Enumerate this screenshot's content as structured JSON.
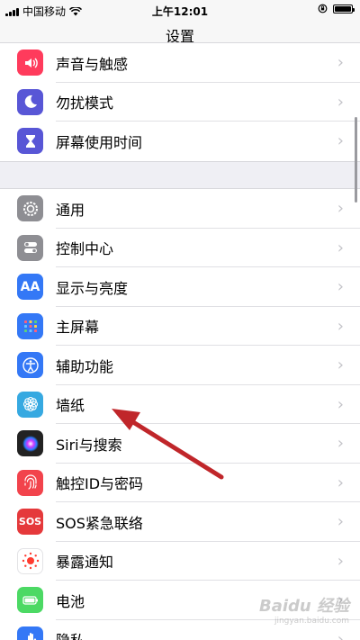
{
  "status_bar": {
    "carrier": "中国移动",
    "time": "上午12:01"
  },
  "nav": {
    "title": "设置"
  },
  "group1": [
    {
      "label": "声音与触感",
      "icon": "speaker-icon",
      "color": "#ff3b5c"
    },
    {
      "label": "勿扰模式",
      "icon": "moon-icon",
      "color": "#5856d6"
    },
    {
      "label": "屏幕使用时间",
      "icon": "hourglass-icon",
      "color": "#5856d6"
    }
  ],
  "group2": [
    {
      "label": "通用",
      "icon": "gear-icon",
      "color": "#8e8e93"
    },
    {
      "label": "控制中心",
      "icon": "toggles-icon",
      "color": "#8e8e93"
    },
    {
      "label": "显示与亮度",
      "icon": "aa-icon",
      "color": "#3478f6",
      "icon_text": "AA"
    },
    {
      "label": "主屏幕",
      "icon": "grid-icon",
      "color": "#3478f6"
    },
    {
      "label": "辅助功能",
      "icon": "accessibility-icon",
      "color": "#3478f6"
    },
    {
      "label": "墙纸",
      "icon": "flower-icon",
      "color": "#36a9e1"
    },
    {
      "label": "Siri与搜索",
      "icon": "siri-icon",
      "color": "#222222"
    },
    {
      "label": "触控ID与密码",
      "icon": "fingerprint-icon",
      "color": "#f2434c"
    },
    {
      "label": "SOS紧急联络",
      "icon": "sos-icon",
      "color": "#e5393b",
      "icon_text": "SOS"
    },
    {
      "label": "暴露通知",
      "icon": "exposure-icon",
      "color": "#ffffff"
    },
    {
      "label": "电池",
      "icon": "battery-icon",
      "color": "#4cd964"
    },
    {
      "label": "隐私",
      "icon": "hand-icon",
      "color": "#3478f6"
    }
  ],
  "watermark": {
    "text": "Baidu 经验",
    "sub": "jingyan.baidu.com"
  }
}
